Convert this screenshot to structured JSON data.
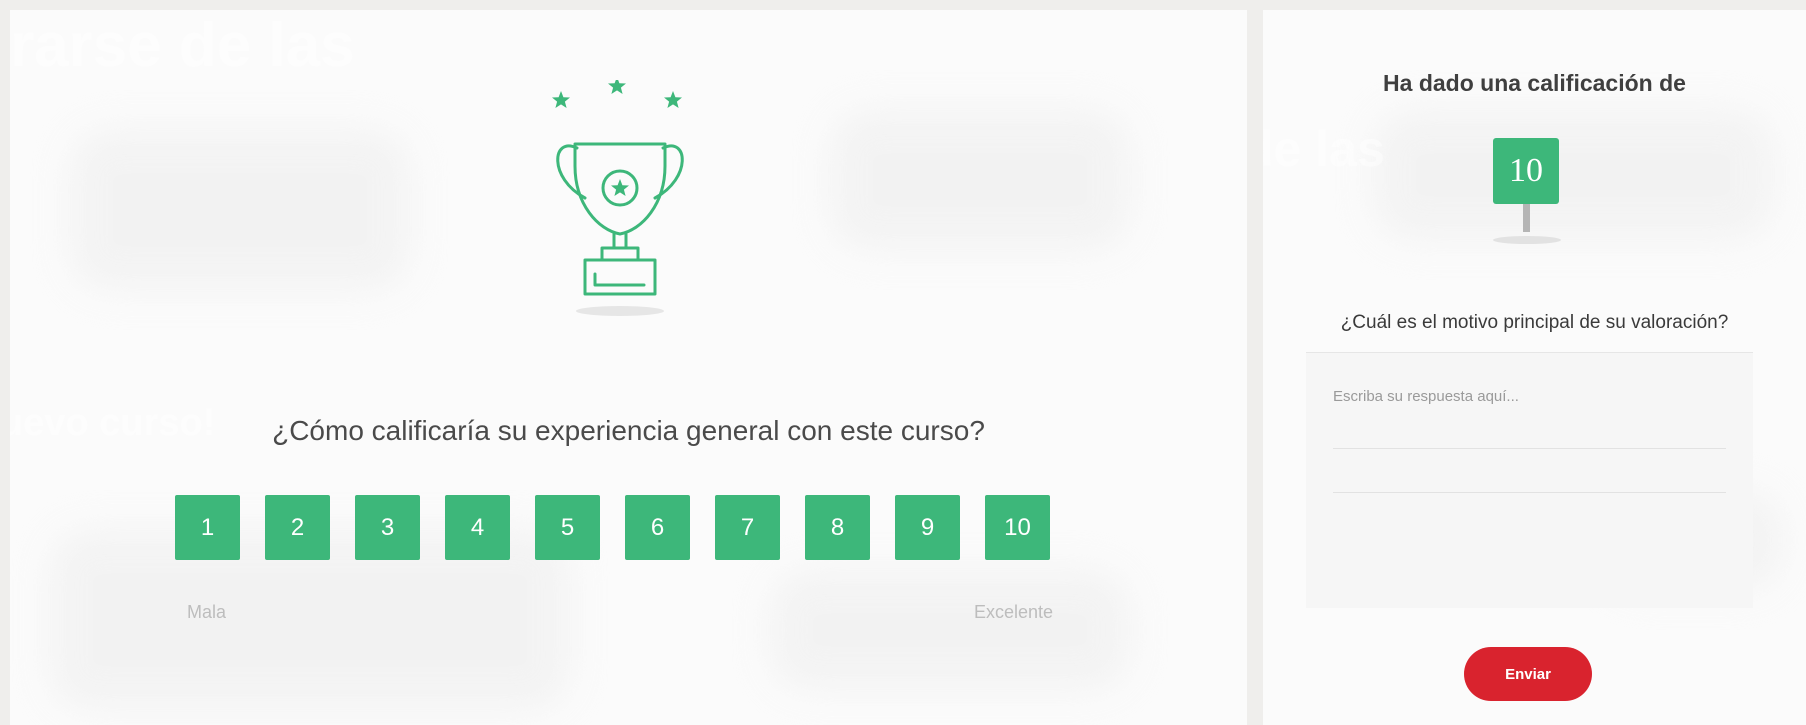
{
  "survey": {
    "question": "¿Cómo calificaría su experiencia general con este curso?",
    "scale_values": [
      "1",
      "2",
      "3",
      "4",
      "5",
      "6",
      "7",
      "8",
      "9",
      "10"
    ],
    "scale_low_label": "Mala",
    "scale_high_label": "Excelente",
    "trophy_icon": "trophy-icon"
  },
  "feedback": {
    "heading": "Ha dado una calificación de",
    "selected_rating": "10",
    "reason_question": "¿Cuál es el motivo principal de su valoración?",
    "answer_placeholder": "Escriba su respuesta aquí...",
    "send_label": "Enviar"
  },
  "background_text": {
    "left_title": "rarse de las",
    "left_subtitle": "uevo curso!",
    "right_title": "de las"
  },
  "colors": {
    "accent_green": "#3db77a",
    "send_red": "#d9232e",
    "page_bg": "#efeeec",
    "panel_bg": "#fbfbfb"
  }
}
